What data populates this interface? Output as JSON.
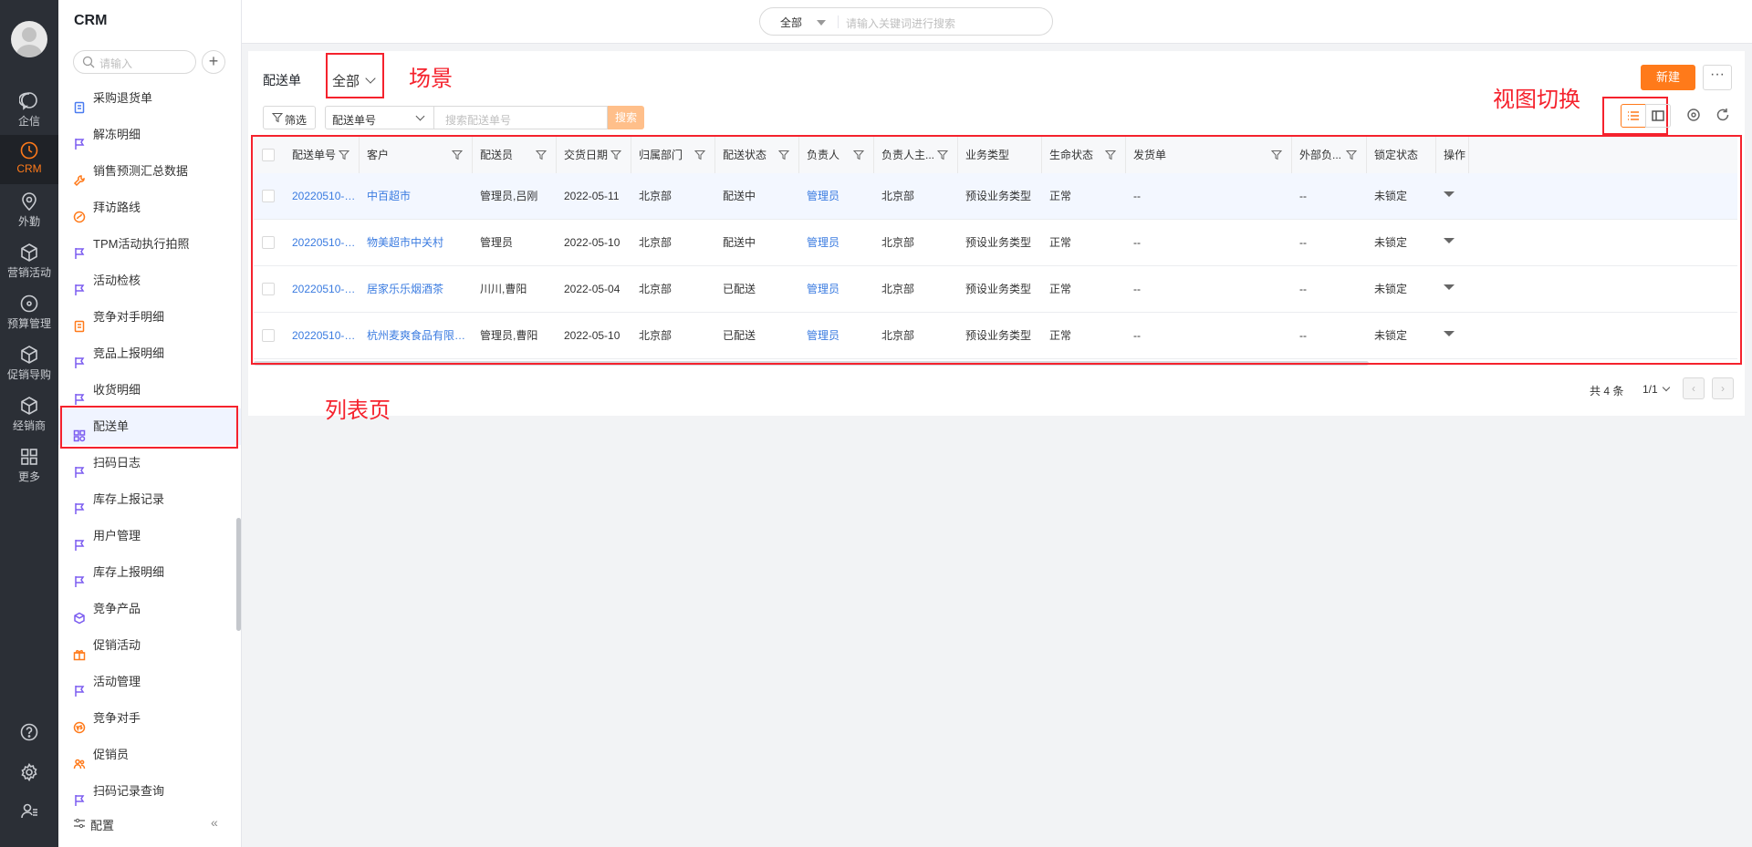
{
  "app": {
    "title": "CRM"
  },
  "rail": {
    "items": [
      {
        "label": "企信",
        "icon": "chat-icon"
      },
      {
        "label": "CRM",
        "icon": "clock-icon",
        "active": true
      },
      {
        "label": "外勤",
        "icon": "location-icon"
      },
      {
        "label": "营销活动",
        "icon": "cube-icon"
      },
      {
        "label": "预算管理",
        "icon": "target-icon"
      },
      {
        "label": "促销导购",
        "icon": "cube-icon"
      },
      {
        "label": "经销商",
        "icon": "cube-icon"
      },
      {
        "label": "更多",
        "icon": "grid-icon"
      }
    ],
    "active_color": "#ff7a1a"
  },
  "sidebar": {
    "search_placeholder": "请输入",
    "add_label": "+",
    "items": [
      {
        "label": "采购退货单",
        "icon": "doc-icon",
        "color": "#4a7bf0"
      },
      {
        "label": "解冻明细",
        "icon": "flag-icon",
        "color": "#7b5cf0"
      },
      {
        "label": "销售预测汇总数据",
        "icon": "wrench-icon",
        "color": "#ff7a1a"
      },
      {
        "label": "拜访路线",
        "icon": "route-icon",
        "color": "#ff7a1a"
      },
      {
        "label": "TPM活动执行拍照",
        "icon": "flag-icon",
        "color": "#7b5cf0"
      },
      {
        "label": "活动检核",
        "icon": "flag-icon",
        "color": "#7b5cf0"
      },
      {
        "label": "竞争对手明细",
        "icon": "doc-icon",
        "color": "#ff7a1a"
      },
      {
        "label": "竞品上报明细",
        "icon": "flag-icon",
        "color": "#7b5cf0"
      },
      {
        "label": "收货明细",
        "icon": "flag-icon",
        "color": "#7b5cf0"
      },
      {
        "label": "配送单",
        "icon": "apps-icon",
        "color": "#7b5cf0",
        "active": true
      },
      {
        "label": "扫码日志",
        "icon": "flag-icon",
        "color": "#7b5cf0"
      },
      {
        "label": "库存上报记录",
        "icon": "flag-icon",
        "color": "#7b5cf0"
      },
      {
        "label": "用户管理",
        "icon": "flag-icon",
        "color": "#7b5cf0"
      },
      {
        "label": "库存上报明细",
        "icon": "flag-icon",
        "color": "#7b5cf0"
      },
      {
        "label": "竞争产品",
        "icon": "box-icon",
        "color": "#7b5cf0"
      },
      {
        "label": "促销活动",
        "icon": "gift-icon",
        "color": "#ff7a1a"
      },
      {
        "label": "活动管理",
        "icon": "flag-icon",
        "color": "#7b5cf0"
      },
      {
        "label": "竞争对手",
        "icon": "vs-icon",
        "color": "#ff7a1a"
      },
      {
        "label": "促销员",
        "icon": "people-icon",
        "color": "#ff7a1a"
      },
      {
        "label": "扫码记录查询",
        "icon": "flag-icon",
        "color": "#7b5cf0"
      }
    ],
    "config_label": "配置",
    "collapse_label": "«"
  },
  "topbar": {
    "search_scope": "全部",
    "search_placeholder": "请输入关键词进行搜索"
  },
  "main": {
    "object_title": "配送单",
    "scene_value": "全部",
    "new_button": "新建",
    "more_button": "···",
    "filter_button": "筛选",
    "search_field": "配送单号",
    "search_placeholder": "搜索配送单号",
    "search_button": "搜索"
  },
  "annotations": {
    "scene": "场景",
    "view_switch": "视图切换",
    "list_page": "列表页",
    "color": "#f5222d"
  },
  "table": {
    "columns": [
      "配送单号",
      "客户",
      "配送员",
      "交货日期",
      "归属部门",
      "配送状态",
      "负责人",
      "负责人主...",
      "业务类型",
      "生命状态",
      "发货单",
      "外部负...",
      "锁定状态",
      "操作"
    ],
    "rows": [
      [
        "20220510-00...",
        "中百超市",
        "管理员,吕刚",
        "2022-05-11",
        "北京部",
        "配送中",
        "管理员",
        "北京部",
        "预设业务类型",
        "正常",
        "--",
        "--",
        "未锁定"
      ],
      [
        "20220510-00...",
        "物美超市中关村",
        "管理员",
        "2022-05-10",
        "北京部",
        "配送中",
        "管理员",
        "北京部",
        "预设业务类型",
        "正常",
        "--",
        "--",
        "未锁定"
      ],
      [
        "20220510-00...",
        "居家乐乐烟酒茶",
        "川川,曹阳",
        "2022-05-04",
        "北京部",
        "已配送",
        "管理员",
        "北京部",
        "预设业务类型",
        "正常",
        "--",
        "--",
        "未锁定"
      ],
      [
        "20220510-00...",
        "杭州麦爽食品有限公司",
        "管理员,曹阳",
        "2022-05-10",
        "北京部",
        "已配送",
        "管理员",
        "北京部",
        "预设业务类型",
        "正常",
        "--",
        "--",
        "未锁定"
      ]
    ],
    "link_color": "#3a7be0"
  },
  "pager": {
    "total": "共 4 条",
    "page": "1/1",
    "prev": "‹",
    "next": "›"
  }
}
